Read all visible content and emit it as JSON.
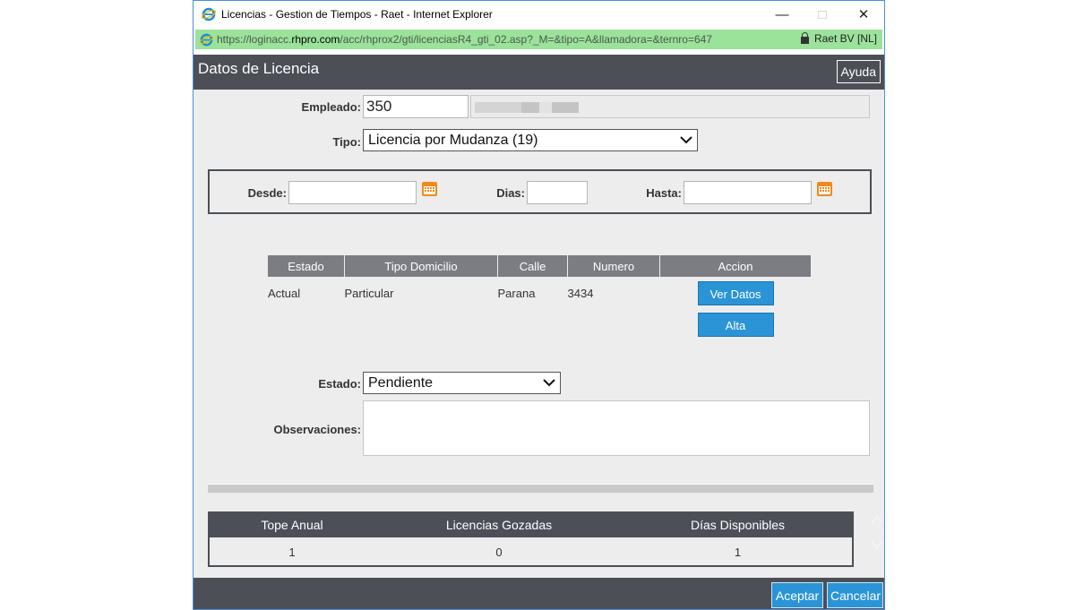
{
  "window": {
    "title": "Licencias - Gestion de Tiempos - Raet - Internet Explorer",
    "minimize": "—",
    "maximize": "□",
    "close": "✕"
  },
  "address_bar": {
    "url_scheme": "https://loginacc.",
    "url_domain": "rhpro.com",
    "url_path": "/acc/rhprox2/gti/licenciasR4_gti_02.asp?_M=&tipo=A&llamadora=&ternro=647",
    "cert_owner": "Raet BV [NL]"
  },
  "header": {
    "title": "Datos de Licencia",
    "help_label": "Ayuda"
  },
  "form": {
    "empleado_label": "Empleado:",
    "empleado_value": "350",
    "tipo_label": "Tipo:",
    "tipo_value": "Licencia por Mudanza (19)",
    "desde_label": "Desde:",
    "desde_value": "",
    "dias_label": "Dias:",
    "dias_value": "",
    "hasta_label": "Hasta:",
    "hasta_value": "",
    "estado_label": "Estado:",
    "estado_value": "Pendiente",
    "observaciones_label": "Observaciones:",
    "observaciones_value": ""
  },
  "domicilio_table": {
    "columns": [
      "Estado",
      "Tipo Domicilio",
      "Calle",
      "Numero",
      "Accion"
    ],
    "rows": [
      {
        "estado": "Actual",
        "tipo": "Particular",
        "calle": "Parana",
        "numero": "3434"
      }
    ],
    "ver_datos_label": "Ver Datos",
    "alta_label": "Alta"
  },
  "summary": {
    "columns": [
      "Tope Anual",
      "Licencias Gozadas",
      "Días Disponibles"
    ],
    "values": [
      "1",
      "0",
      "1"
    ]
  },
  "footer": {
    "accept_label": "Aceptar",
    "cancel_label": "Cancelar"
  },
  "colors": {
    "header_bg": "#4d4f56",
    "accent_blue": "#2a94d6",
    "address_green": "#9be29a"
  }
}
